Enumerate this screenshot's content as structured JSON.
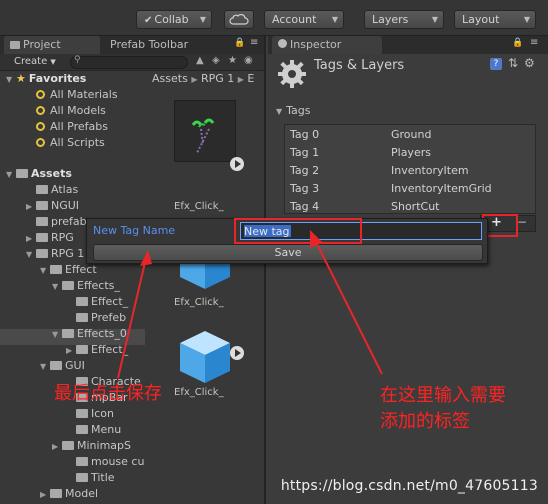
{
  "toolbar": {
    "collab_label": "Collab",
    "account_label": "Account",
    "layers_label": "Layers",
    "layout_label": "Layout"
  },
  "project_panel": {
    "tab_project": "Project",
    "tab_prefab_toolbar": "Prefab Toolbar",
    "create_label": "Create",
    "favorites": {
      "title": "Favorites",
      "items": [
        "All Materials",
        "All Models",
        "All Prefabs",
        "All Scripts"
      ]
    },
    "assets": {
      "title": "Assets",
      "items": [
        "Atlas",
        "NGUI",
        "prefab",
        "RPG",
        "RPG 1",
        "Effect",
        "Effects_",
        "Effect_",
        "Prefeb",
        "Effects_0",
        "Effect_",
        "GUI",
        "Characte",
        "mpBar",
        "Icon",
        "Menu",
        "MinimapS",
        "mouse cu",
        "Title",
        "Model"
      ]
    },
    "breadcrumb": [
      "Assets",
      "RPG 1",
      "E"
    ],
    "thumbnails": [
      "Efx_Click_",
      "Efx_Click_",
      "Efx_Click_"
    ]
  },
  "inspector": {
    "tab_label": "Inspector",
    "title": "Tags & Layers",
    "section_label": "Tags",
    "tags": [
      {
        "key": "Tag 0",
        "value": "Ground"
      },
      {
        "key": "Tag 1",
        "value": "Players"
      },
      {
        "key": "Tag 2",
        "value": "InventoryItem"
      },
      {
        "key": "Tag 3",
        "value": "InventoryItemGrid"
      },
      {
        "key": "Tag 4",
        "value": "ShortCut"
      }
    ],
    "plus_label": "+",
    "minus_label": "−"
  },
  "popup": {
    "field_label": "New Tag Name",
    "field_value": "New tag",
    "save_label": "Save"
  },
  "annotations": {
    "left_note": "最后点击保存",
    "right_note_line1": "在这里输入需要",
    "right_note_line2": "添加的标签"
  },
  "watermark": "https://blog.csdn.net/m0_47605113",
  "colors": {
    "annotation_red": "#e8262a",
    "selection_blue": "#3b6cc6",
    "label_blue": "#5b8ff0"
  }
}
